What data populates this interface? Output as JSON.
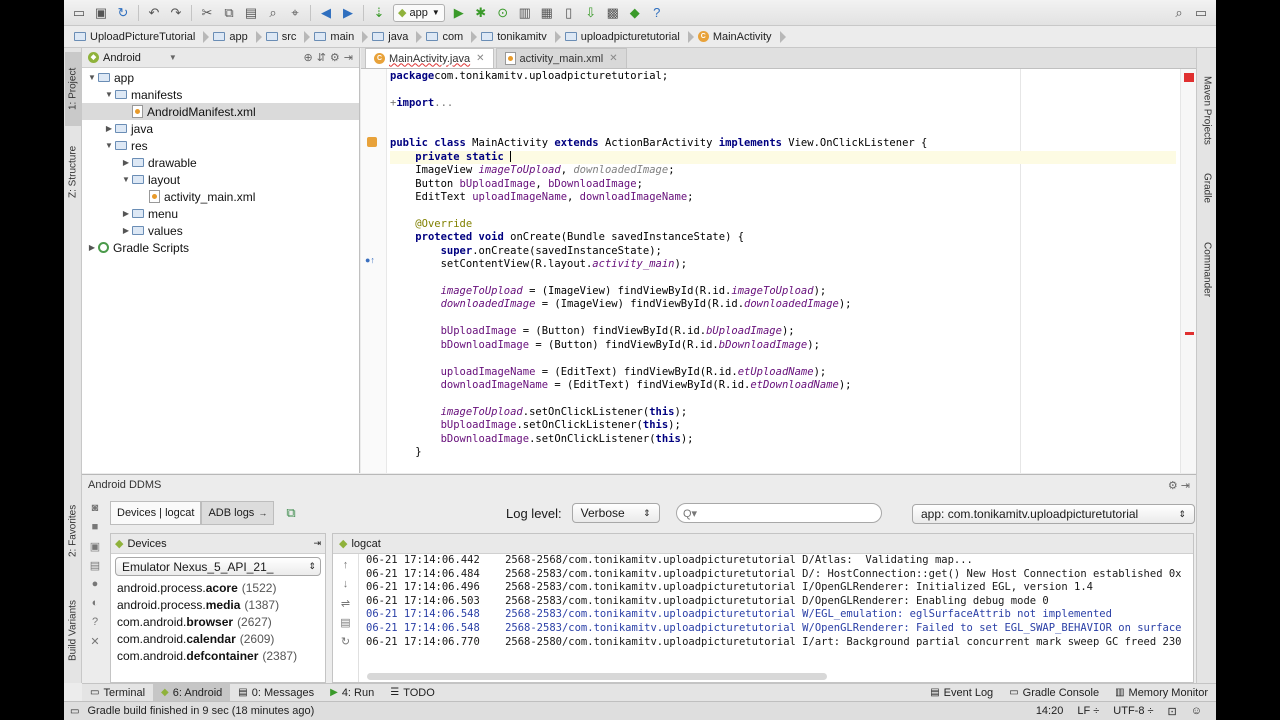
{
  "toolbar": {
    "run_config": "app",
    "icons": [
      "save-icon",
      "sync-icon",
      "undo-icon",
      "redo-icon",
      "cut-icon",
      "copy-icon",
      "paste-icon",
      "find-icon",
      "replace-icon",
      "back-icon",
      "forward-icon",
      "make-icon",
      "run-icon",
      "debug-icon",
      "attach-icon",
      "sdk-icon",
      "avd-icon",
      "device-monitor-icon",
      "android-icon",
      "help-icon",
      "search-icon"
    ]
  },
  "breadcrumbs": [
    "UploadPictureTutorial",
    "app",
    "src",
    "main",
    "java",
    "com",
    "tonikamitv",
    "uploadpicturetutorial",
    "MainActivity"
  ],
  "left_stripe": {
    "project": "1: Project",
    "structure": "Z: Structure",
    "favorites": "2: Favorites",
    "build_variants": "Build Variants"
  },
  "right_stripe": {
    "maven": "Maven Projects",
    "gradle": "Gradle",
    "commander": "Commander"
  },
  "project": {
    "view_mode": "Android",
    "tree": [
      {
        "label": "app",
        "depth": 0,
        "arrow": "down",
        "icon": "module-icon"
      },
      {
        "label": "manifests",
        "depth": 1,
        "arrow": "down",
        "icon": "folder-icon"
      },
      {
        "label": "AndroidManifest.xml",
        "depth": 2,
        "arrow": "",
        "icon": "xml-file-icon",
        "selected": true
      },
      {
        "label": "java",
        "depth": 1,
        "arrow": "right",
        "icon": "folder-icon"
      },
      {
        "label": "res",
        "depth": 1,
        "arrow": "down",
        "icon": "folder-icon"
      },
      {
        "label": "drawable",
        "depth": 2,
        "arrow": "right",
        "icon": "folder-icon"
      },
      {
        "label": "layout",
        "depth": 2,
        "arrow": "down",
        "icon": "folder-icon"
      },
      {
        "label": "activity_main.xml",
        "depth": 3,
        "arrow": "",
        "icon": "xml-file-icon"
      },
      {
        "label": "menu",
        "depth": 2,
        "arrow": "right",
        "icon": "folder-icon"
      },
      {
        "label": "values",
        "depth": 2,
        "arrow": "right",
        "icon": "folder-icon"
      },
      {
        "label": "Gradle Scripts",
        "depth": 0,
        "arrow": "right",
        "icon": "gradle-icon"
      }
    ]
  },
  "editor": {
    "tabs": [
      {
        "label": "MainActivity.java",
        "active": true
      },
      {
        "label": "activity_main.xml",
        "active": false
      }
    ],
    "lines": [
      {
        "t": [
          [
            "kw",
            "package"
          ],
          [
            "",
            "com.tonikamitv.uploadpicturetutorial;"
          ]
        ]
      },
      {
        "t": []
      },
      {
        "t": [
          [
            "fold",
            "+"
          ],
          [
            "kw",
            "import"
          ],
          [
            "fold",
            "..."
          ]
        ]
      },
      {
        "t": []
      },
      {
        "t": []
      },
      {
        "t": [
          [
            "kw",
            "public class"
          ],
          [
            "",
            " MainActivity "
          ],
          [
            "kw",
            "extends"
          ],
          [
            "",
            " ActionBarActivity "
          ],
          [
            "kw",
            "implements"
          ],
          [
            "",
            " View.OnClickListener {"
          ]
        ]
      },
      {
        "t": [
          [
            "",
            "    "
          ],
          [
            "kw",
            "private static"
          ],
          [
            "",
            " "
          ]
        ],
        "cur": true
      },
      {
        "t": [
          [
            "",
            "    ImageView "
          ],
          [
            "fldi",
            "imageToUpload"
          ],
          [
            "",
            ", "
          ],
          [
            "unused",
            "downloadedImage"
          ],
          [
            "",
            ";"
          ]
        ]
      },
      {
        "t": [
          [
            "",
            "    Button "
          ],
          [
            "fld",
            "bUploadImage"
          ],
          [
            "",
            ", "
          ],
          [
            "fld",
            "bDownloadImage"
          ],
          [
            "",
            ";"
          ]
        ]
      },
      {
        "t": [
          [
            "",
            "    EditText "
          ],
          [
            "fld",
            "uploadImageName"
          ],
          [
            "",
            ", "
          ],
          [
            "fld",
            "downloadImageName"
          ],
          [
            "",
            ";"
          ]
        ]
      },
      {
        "t": []
      },
      {
        "t": [
          [
            "",
            "    "
          ],
          [
            "ann",
            "@Override"
          ]
        ]
      },
      {
        "t": [
          [
            "",
            "    "
          ],
          [
            "kw",
            "protected void"
          ],
          [
            "",
            " onCreate(Bundle savedInstanceState) {"
          ]
        ]
      },
      {
        "t": [
          [
            "",
            "        "
          ],
          [
            "kw",
            "super"
          ],
          [
            "",
            ".onCreate(savedInstanceState);"
          ]
        ]
      },
      {
        "t": [
          [
            "",
            "        setContentView(R.layout."
          ],
          [
            "fldi",
            "activity_main"
          ],
          [
            "",
            ");"
          ]
        ]
      },
      {
        "t": []
      },
      {
        "t": [
          [
            "",
            "        "
          ],
          [
            "fldi",
            "imageToUpload"
          ],
          [
            "",
            " = (ImageView) findViewById(R.id."
          ],
          [
            "fldi",
            "imageToUpload"
          ],
          [
            "",
            ");"
          ]
        ]
      },
      {
        "t": [
          [
            "",
            "        "
          ],
          [
            "fldi",
            "downloadedImage"
          ],
          [
            "",
            " = (ImageView) findViewById(R.id."
          ],
          [
            "fldi",
            "downloadedImage"
          ],
          [
            "",
            ");"
          ]
        ]
      },
      {
        "t": []
      },
      {
        "t": [
          [
            "",
            "        "
          ],
          [
            "fld",
            "bUploadImage"
          ],
          [
            "",
            " = (Button) findViewById(R.id."
          ],
          [
            "fldi",
            "bUploadImage"
          ],
          [
            "",
            ");"
          ]
        ]
      },
      {
        "t": [
          [
            "",
            "        "
          ],
          [
            "fld",
            "bDownloadImage"
          ],
          [
            "",
            " = (Button) findViewById(R.id."
          ],
          [
            "fldi",
            "bDownloadImage"
          ],
          [
            "",
            ");"
          ]
        ]
      },
      {
        "t": []
      },
      {
        "t": [
          [
            "",
            "        "
          ],
          [
            "fld",
            "uploadImageName"
          ],
          [
            "",
            " = (EditText) findViewById(R.id."
          ],
          [
            "fldi",
            "etUploadName"
          ],
          [
            "",
            ");"
          ]
        ]
      },
      {
        "t": [
          [
            "",
            "        "
          ],
          [
            "fld",
            "downloadImageName"
          ],
          [
            "",
            " = (EditText) findViewById(R.id."
          ],
          [
            "fldi",
            "etDownloadName"
          ],
          [
            "",
            ");"
          ]
        ]
      },
      {
        "t": []
      },
      {
        "t": [
          [
            "",
            "        "
          ],
          [
            "fldi",
            "imageToUpload"
          ],
          [
            "",
            ".setOnClickListener("
          ],
          [
            "kw",
            "this"
          ],
          [
            "",
            ");"
          ]
        ]
      },
      {
        "t": [
          [
            "",
            "        "
          ],
          [
            "fld",
            "bUploadImage"
          ],
          [
            "",
            ".setOnClickListener("
          ],
          [
            "kw",
            "this"
          ],
          [
            "",
            ");"
          ]
        ]
      },
      {
        "t": [
          [
            "",
            "        "
          ],
          [
            "fld",
            "bDownloadImage"
          ],
          [
            "",
            ".setOnClickListener("
          ],
          [
            "kw",
            "this"
          ],
          [
            "",
            ");"
          ]
        ]
      },
      {
        "t": [
          [
            "",
            "    }"
          ]
        ]
      }
    ]
  },
  "ddms": {
    "title": "Android DDMS",
    "tab_devices": "Devices | logcat",
    "tab_adb": "ADB logs",
    "log_level_label": "Log level:",
    "log_level_value": "Verbose",
    "search_placeholder": "Q▾",
    "app_filter": "app: com.tonikamitv.uploadpicturetutorial",
    "devices_header": "Devices",
    "emulator": "Emulator Nexus_5_API_21_",
    "processes": [
      {
        "name": "android.process.",
        "bold": "acore",
        "pid": "(1522)"
      },
      {
        "name": "android.process.",
        "bold": "media",
        "pid": "(1387)"
      },
      {
        "name": "com.android.",
        "bold": "browser",
        "pid": "(2627)"
      },
      {
        "name": "com.android.",
        "bold": "calendar",
        "pid": "(2609)"
      },
      {
        "name": "com.android.",
        "bold": "defcontainer",
        "pid": "(2387)"
      }
    ],
    "logcat_header": "logcat",
    "log_lines": [
      {
        "text": "06-21 17:14:06.442    2568-2568/com.tonikamitv.uploadpicturetutorial D/Atlas:  Validating map...",
        "level": "d"
      },
      {
        "text": "06-21 17:14:06.484    2568-2583/com.tonikamitv.uploadpicturetutorial D/: HostConnection::get() New Host Connection established 0x",
        "level": "d"
      },
      {
        "text": "06-21 17:14:06.496    2568-2583/com.tonikamitv.uploadpicturetutorial I/OpenGLRenderer: Initialized EGL, version 1.4",
        "level": "d"
      },
      {
        "text": "06-21 17:14:06.503    2568-2583/com.tonikamitv.uploadpicturetutorial D/OpenGLRenderer: Enabling debug mode 0",
        "level": "d"
      },
      {
        "text": "06-21 17:14:06.548    2568-2583/com.tonikamitv.uploadpicturetutorial W/EGL_emulation: eglSurfaceAttrib not implemented",
        "level": "w"
      },
      {
        "text": "06-21 17:14:06.548    2568-2583/com.tonikamitv.uploadpicturetutorial W/OpenGLRenderer: Failed to set EGL_SWAP_BEHAVIOR on surface",
        "level": "w"
      },
      {
        "text": "06-21 17:14:06.770    2568-2580/com.tonikamitv.uploadpicturetutorial I/art: Background partial concurrent mark sweep GC freed 230",
        "level": "d"
      }
    ]
  },
  "bottom_tools": {
    "terminal": "Terminal",
    "android": "6: Android",
    "messages": "0: Messages",
    "run": "4: Run",
    "todo": "TODO",
    "event_log": "Event Log",
    "gradle_console": "Gradle Console",
    "memory_monitor": "Memory Monitor"
  },
  "status": {
    "message": "Gradle build finished in 9 sec (18 minutes ago)",
    "position": "14:20",
    "line_sep": "LF ÷",
    "encoding": "UTF-8 ÷"
  },
  "colors": {
    "keyword": "#000080",
    "field": "#660e7a",
    "annotation": "#808000",
    "warning": "#2a3fa6",
    "error_mark": "#e03030"
  }
}
